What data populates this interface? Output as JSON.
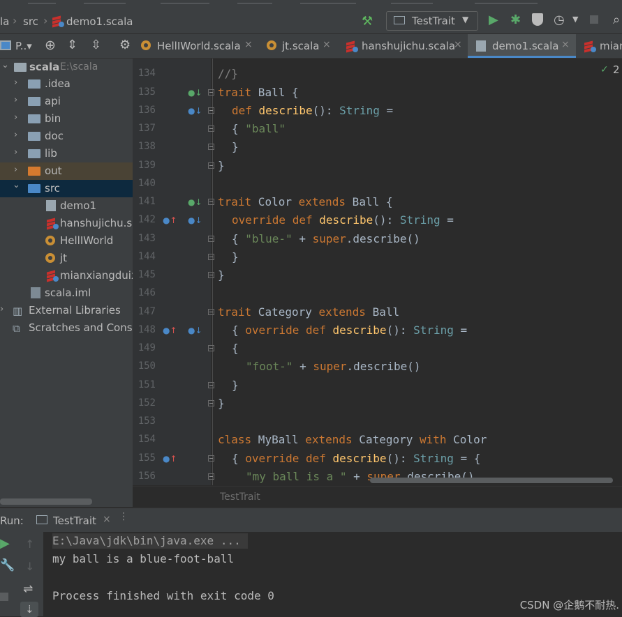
{
  "navbar": {
    "breadcrumb": [
      "la",
      "src",
      "demo1.scala"
    ],
    "run_config": "TestTrait"
  },
  "tabs": [
    {
      "label": "P..▾"
    },
    {
      "label": "HellIWorld.scala"
    },
    {
      "label": "jt.scala"
    },
    {
      "label": "hanshujichu.scala"
    },
    {
      "label": "demo1.scala"
    },
    {
      "label": "mian"
    }
  ],
  "inspection_count": "2",
  "tree": {
    "root": {
      "label": "scala",
      "hint": "E:\\scala"
    },
    "items": [
      {
        "label": ".idea"
      },
      {
        "label": "api"
      },
      {
        "label": "bin"
      },
      {
        "label": "doc"
      },
      {
        "label": "lib"
      },
      {
        "label": "out"
      },
      {
        "label": "src"
      },
      {
        "label": "demo1"
      },
      {
        "label": "hanshujichu.sc"
      },
      {
        "label": "HellIWorld"
      },
      {
        "label": "jt"
      },
      {
        "label": "mianxiangduix"
      },
      {
        "label": "scala.iml"
      },
      {
        "label": "External Libraries"
      },
      {
        "label": "Scratches and Conso"
      }
    ]
  },
  "editor": {
    "line_numbers": [
      "134",
      "135",
      "136",
      "137",
      "138",
      "139",
      "140",
      "141",
      "142",
      "143",
      "144",
      "145",
      "146",
      "147",
      "148",
      "149",
      "150",
      "151",
      "152",
      "153",
      "154",
      "155",
      "156"
    ],
    "top_partial": "//}",
    "lines": {
      "l135": [
        "trait",
        " Ball {"
      ],
      "l136": [
        "def ",
        "describe",
        "(): ",
        "String",
        " ="
      ],
      "l137": [
        "{ ",
        "\"ball\""
      ],
      "l138": [
        "}"
      ],
      "l139": [
        "}"
      ],
      "l141": [
        "trait",
        " Color ",
        "extends",
        " Ball {"
      ],
      "l142": [
        "override def ",
        "describe",
        "(): ",
        "String",
        " ="
      ],
      "l143": [
        "{ ",
        "\"blue-\"",
        " + ",
        "super",
        ".describe()"
      ],
      "l144": [
        "}"
      ],
      "l145": [
        "}"
      ],
      "l147": [
        "trait",
        " Category ",
        "extends",
        " Ball"
      ],
      "l148": [
        "{ ",
        "override def ",
        "describe",
        "(): ",
        "String",
        " ="
      ],
      "l149": [
        "{"
      ],
      "l150": [
        "\"foot-\"",
        " + ",
        "super",
        ".describe()"
      ],
      "l151": [
        "}"
      ],
      "l152": [
        "}"
      ],
      "l154": [
        "class",
        " MyBall ",
        "extends",
        " Category ",
        "with",
        " Color"
      ],
      "l155": [
        "{ ",
        "override def ",
        "describe",
        "(): ",
        "String",
        " = {"
      ],
      "l156": [
        "\"my ball is a \"",
        " + ",
        "super",
        ".describe()"
      ]
    },
    "breadcrumb": "TestTrait"
  },
  "run": {
    "label": "Run:",
    "tab": "TestTrait",
    "console": [
      "E:\\Java\\jdk\\bin\\java.exe ...",
      "my ball is a blue-foot-ball",
      "",
      "Process finished with exit code 0"
    ]
  },
  "watermark": "CSDN @企鹅不耐热."
}
